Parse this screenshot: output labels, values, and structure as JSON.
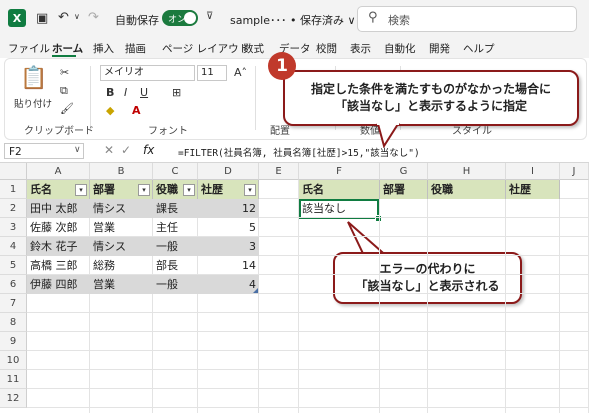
{
  "titlebar": {
    "app_icon": "excel-icon",
    "autosave_label": "自動保存",
    "autosave_state": "オン",
    "filename": "sample･･･ • 保存済み ∨",
    "search_placeholder": "検索"
  },
  "menu": [
    "ファイル",
    "ホーム",
    "挿入",
    "描画",
    "ページ レイアウト",
    "数式",
    "データ",
    "校閲",
    "表示",
    "自動化",
    "開発",
    "ヘルプ"
  ],
  "ribbon": {
    "paste_label": "貼り付け",
    "font_name": "メイリオ",
    "font_size": "11",
    "groups": [
      "クリップボード",
      "フォント",
      "配置",
      "数値",
      "スタイル"
    ]
  },
  "formula_bar": {
    "name_box": "F2",
    "fx": "fx",
    "formula": "=FILTER(社員名簿, 社員名簿[社歴]>15,\"該当なし\")"
  },
  "columns": [
    "A",
    "B",
    "C",
    "D",
    "E",
    "F",
    "G",
    "H",
    "I",
    "J"
  ],
  "rows": [
    "1",
    "2",
    "3",
    "4",
    "5",
    "6",
    "7",
    "8",
    "9",
    "10",
    "11",
    "12"
  ],
  "table": {
    "headers": [
      "氏名",
      "部署",
      "役職",
      "社歴"
    ],
    "rows": [
      [
        "田中 太郎",
        "情シス",
        "課長",
        "12"
      ],
      [
        "佐藤 次郎",
        "営業",
        "主任",
        "5"
      ],
      [
        "鈴木 花子",
        "情シス",
        "一般",
        "3"
      ],
      [
        "高橋 三郎",
        "総務",
        "部長",
        "14"
      ],
      [
        "伊藤 四郎",
        "営業",
        "一般",
        "4"
      ]
    ]
  },
  "result": {
    "headers": [
      "氏名",
      "部署",
      "役職",
      "社歴"
    ],
    "value": "該当なし"
  },
  "callout1": {
    "badge": "1",
    "line1": "指定した条件を満たすものがなかった場合に",
    "line2": "「該当なし」と表示するように指定"
  },
  "callout2": {
    "line1": "エラーの代わりに",
    "line2": "「該当なし」と表示される"
  },
  "colors": {
    "accent": "#107c41",
    "header_fill": "#d8e4bc",
    "band_fill": "#d9d9d9",
    "callout_border": "#8b1a1a",
    "badge": "#c0392b"
  }
}
